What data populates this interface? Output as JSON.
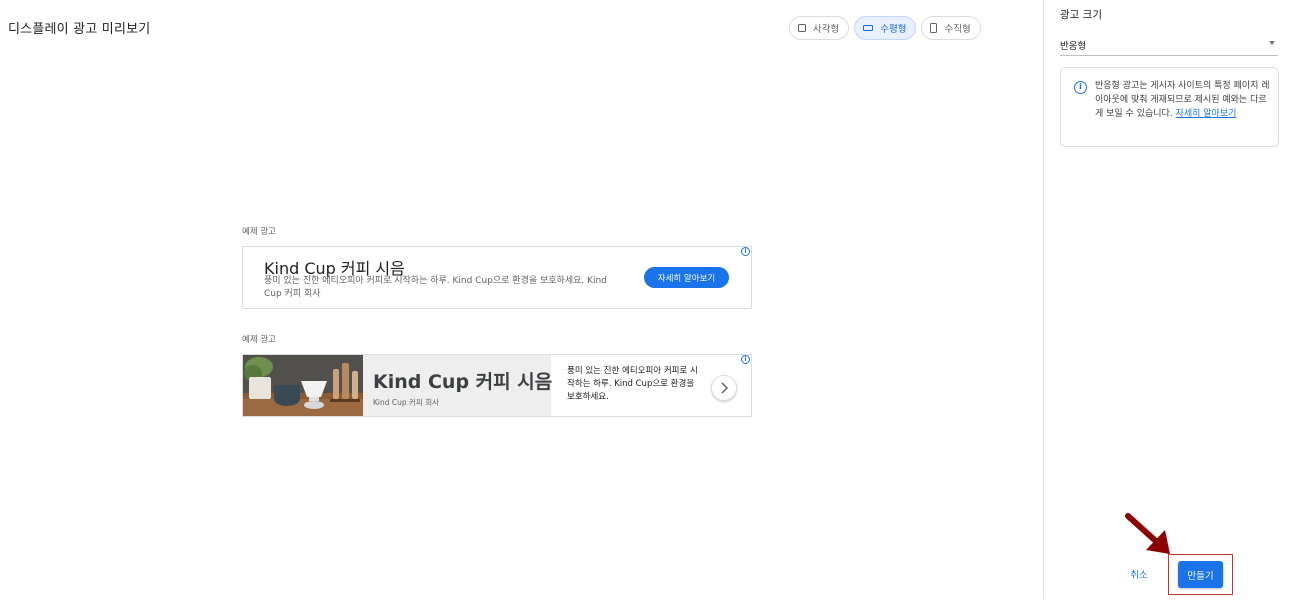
{
  "header": {
    "title": "디스플레이 광고 미리보기"
  },
  "orientation": {
    "options": [
      {
        "label": "사각형",
        "icon": "square-icon",
        "selected": false
      },
      {
        "label": "수평형",
        "icon": "horizontal-rect-icon",
        "selected": true
      },
      {
        "label": "수직형",
        "icon": "vertical-rect-icon",
        "selected": false
      }
    ]
  },
  "preview": {
    "ad_label": "예제 광고",
    "text_ad": {
      "headline": "Kind Cup 커피 시음",
      "description": "풍미 있는 진한 에티오피아 커피로 시작하는 하루. Kind Cup으로 환경을 보호하세요. Kind Cup 커피 회사",
      "cta": "자세히 알아보기",
      "info_icon": "info-icon"
    },
    "image_ad": {
      "headline": "Kind Cup 커피 시음",
      "business": "Kind Cup 커피 회사",
      "description": "풍미 있는 진한 에티오피아 커피로 시작하는 하루. Kind Cup으로 환경을 보호하세요.",
      "next_icon": "chevron-right-icon",
      "info_icon": "info-icon"
    }
  },
  "panel": {
    "size_label": "광고 크기",
    "size_value": "반응형",
    "notice": {
      "icon": "info-icon",
      "text": "반응형 광고는 게시자 사이트의 특정 페이지 레이아웃에 맞춰 게재되므로 제시된 예와는 다르게 보일 수 있습니다.",
      "link": "자세히 알아보기"
    }
  },
  "actions": {
    "cancel": "취소",
    "create": "만들기"
  },
  "colors": {
    "primary": "#1a73e8",
    "highlight": "#c0392b",
    "pointer": "#8b0000"
  }
}
